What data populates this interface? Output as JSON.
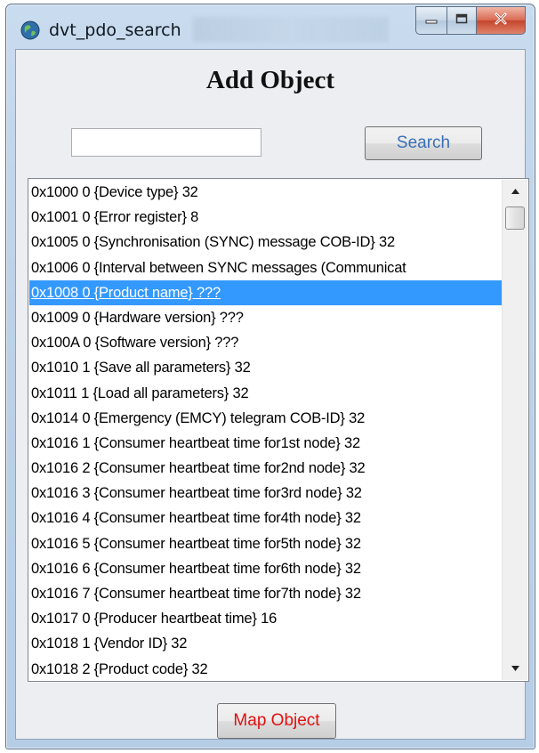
{
  "window": {
    "title": "dvt_pdo_search"
  },
  "dialog": {
    "heading": "Add Object",
    "search_input_value": "",
    "search_button": "Search",
    "map_button": "Map Object"
  },
  "list": {
    "selected_index": 4,
    "items": [
      "0x1000 0 {Device type} 32",
      "0x1001 0 {Error register} 8",
      "0x1005 0 {Synchronisation (SYNC) message COB-ID} 32",
      "0x1006 0 {Interval between SYNC messages (Communicat",
      "0x1008 0 {Product name} ???",
      "0x1009 0 {Hardware version} ???",
      "0x100A 0 {Software version} ???",
      "0x1010 1 {Save all parameters} 32",
      "0x1011 1 {Load all parameters} 32",
      "0x1014 0 {Emergency (EMCY) telegram COB-ID} 32",
      "0x1016 1 {Consumer heartbeat time for1st node} 32",
      "0x1016 2 {Consumer heartbeat time for2nd node} 32",
      "0x1016 3 {Consumer heartbeat time for3rd node} 32",
      "0x1016 4 {Consumer heartbeat time for4th node} 32",
      "0x1016 5 {Consumer heartbeat time for5th node} 32",
      "0x1016 6 {Consumer heartbeat time for6th node} 32",
      "0x1016 7 {Consumer heartbeat time for7th node} 32",
      "0x1017 0 {Producer heartbeat time} 16",
      "0x1018 1 {Vendor ID} 32",
      "0x1018 2 {Product code} 32"
    ]
  },
  "icons": {
    "app": "globe-icon",
    "minimize": "minimize-icon",
    "maximize": "maximize-icon",
    "close": "close-icon",
    "scroll_up": "scroll-up-arrow-icon",
    "scroll_down": "scroll-down-arrow-icon"
  },
  "colors": {
    "selection": "#3399ff",
    "search_button_text": "#3a6fb5",
    "map_button_text": "#e01010",
    "close_button": "#c4442b"
  }
}
